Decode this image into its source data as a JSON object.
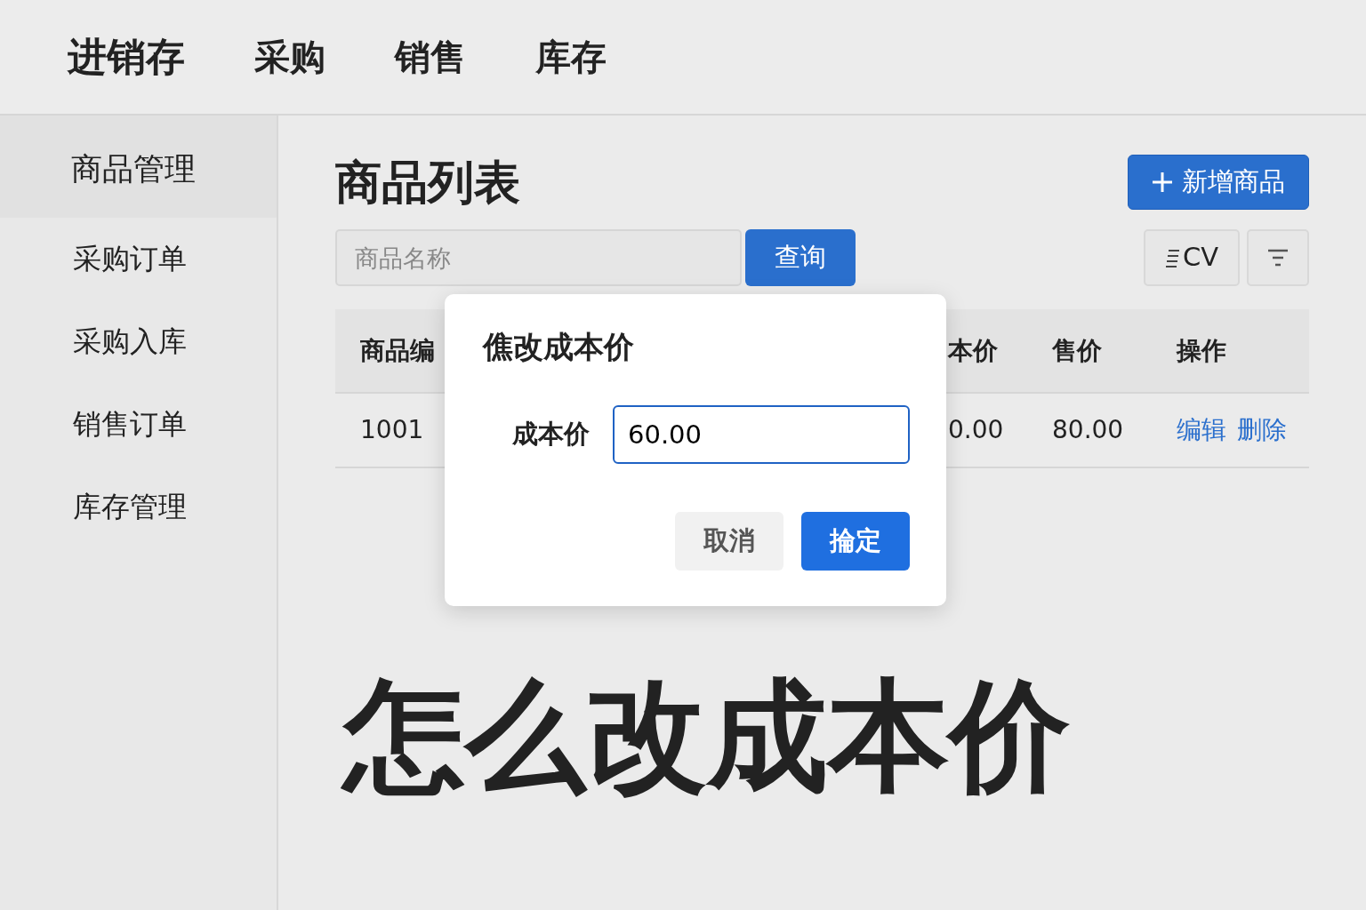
{
  "topnav": {
    "brand": "进销存",
    "items": [
      {
        "label": "采购"
      },
      {
        "label": "销售"
      },
      {
        "label": "库存"
      }
    ]
  },
  "sidebar": {
    "items": [
      {
        "label": "商品管理",
        "selected": true
      },
      {
        "label": "采购订单",
        "selected": false
      },
      {
        "label": "采购入库",
        "selected": false
      },
      {
        "label": "销售订单",
        "selected": false
      },
      {
        "label": "库存管理",
        "selected": false
      }
    ]
  },
  "page": {
    "title": "商品列表",
    "add_button": "新增商品"
  },
  "toolbar": {
    "search": {
      "placeholder": "商品名称"
    },
    "search_button": "查询",
    "export_button": "CV"
  },
  "table": {
    "columns": [
      "商品编",
      "本价",
      "售价",
      "操作"
    ],
    "rows": [
      {
        "cells": [
          "1001",
          "0.00",
          "80.00"
        ],
        "actions": [
          "编辑",
          "删除"
        ]
      }
    ]
  },
  "dialog": {
    "title": "僬改成本价",
    "field": {
      "label": "成本价",
      "value": "60.00"
    },
    "buttons": [
      {
        "label": "取消",
        "kind": "secondary"
      },
      {
        "label": "掄定",
        "kind": "primary"
      }
    ]
  },
  "caption": "怎么改成本价"
}
